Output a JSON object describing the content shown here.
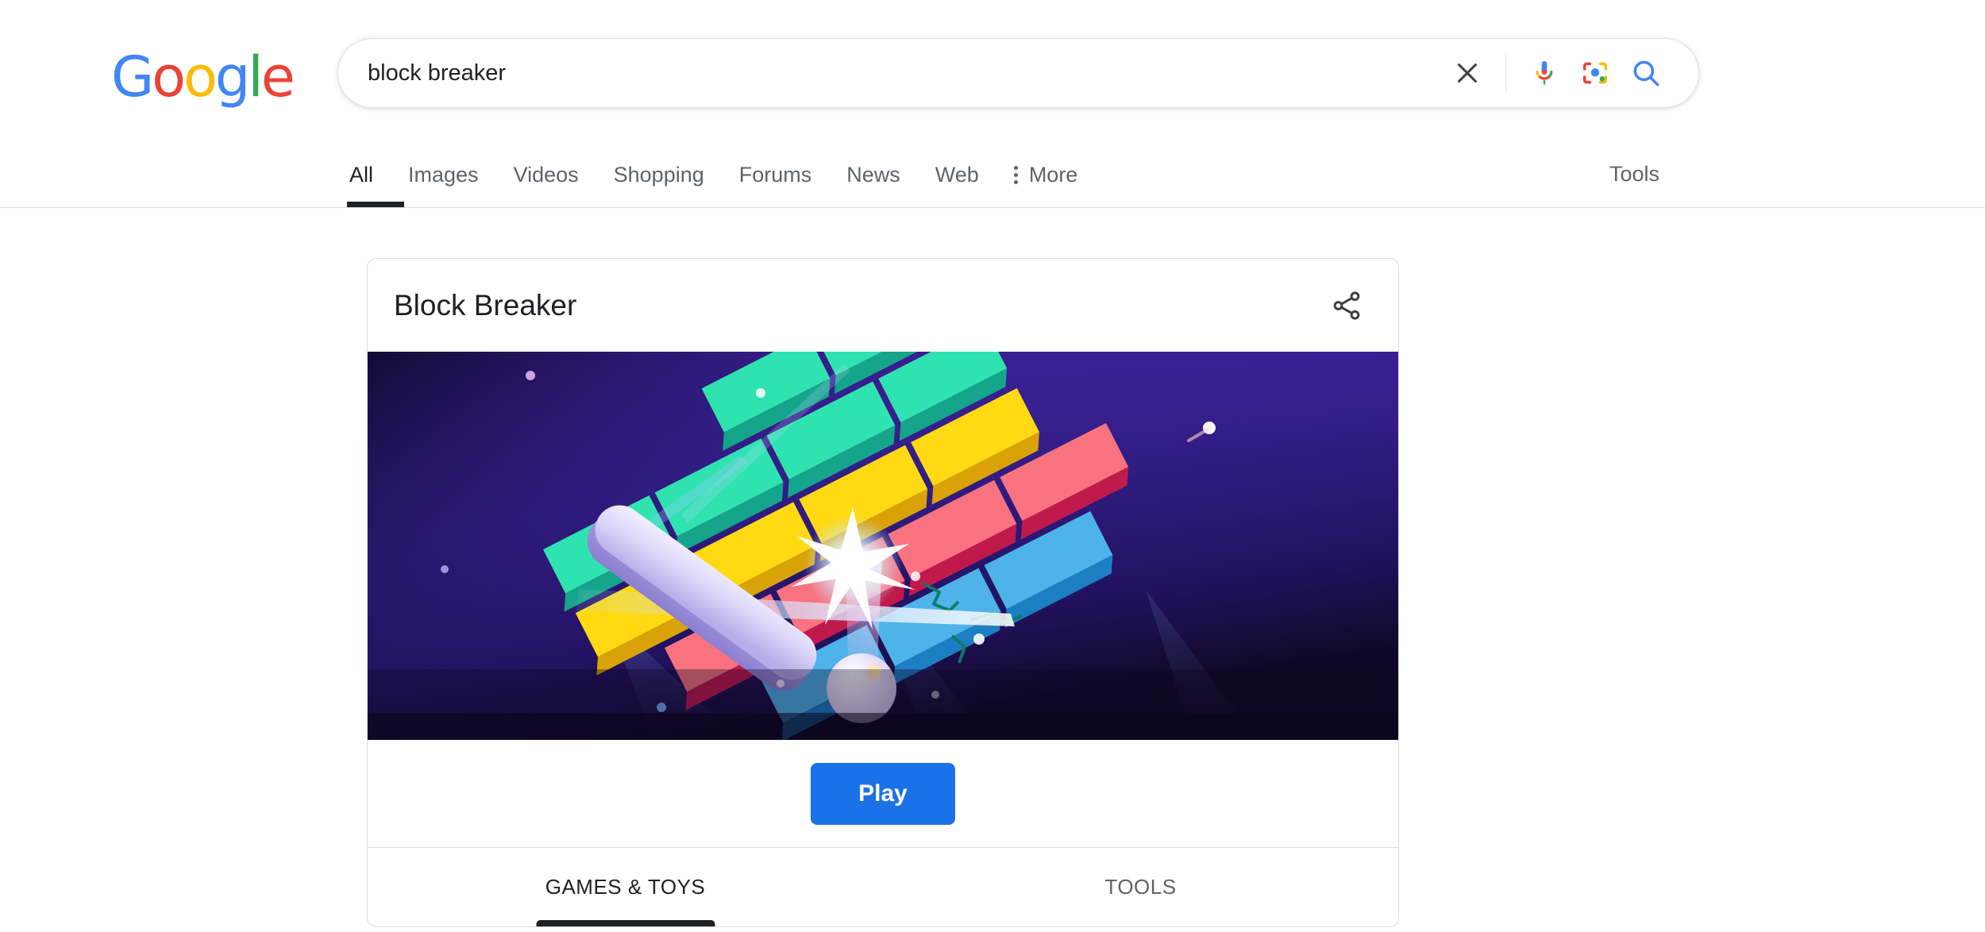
{
  "brand": {
    "logo_letters": [
      {
        "char": "G",
        "color": "#4285F4"
      },
      {
        "char": "o",
        "color": "#EA4335"
      },
      {
        "char": "o",
        "color": "#FBBC05"
      },
      {
        "char": "g",
        "color": "#4285F4"
      },
      {
        "char": "l",
        "color": "#34A853"
      },
      {
        "char": "e",
        "color": "#EA4335"
      }
    ],
    "logo_text": "Google"
  },
  "search": {
    "query": "block breaker",
    "placeholder": "Search",
    "clear_label": "Clear",
    "voice_label": "Search by voice",
    "lens_label": "Search by image",
    "submit_label": "Google Search"
  },
  "nav": {
    "items": [
      {
        "label": "All",
        "active": true
      },
      {
        "label": "Images",
        "active": false
      },
      {
        "label": "Videos",
        "active": false
      },
      {
        "label": "Shopping",
        "active": false
      },
      {
        "label": "Forums",
        "active": false
      },
      {
        "label": "News",
        "active": false
      },
      {
        "label": "Web",
        "active": false
      }
    ],
    "more_label": "More",
    "tools_label": "Tools"
  },
  "card": {
    "title": "Block Breaker",
    "share_label": "Share",
    "play_label": "Play",
    "tabs": [
      {
        "label": "GAMES & TOYS",
        "active": true
      },
      {
        "label": "TOOLS",
        "active": false
      }
    ]
  },
  "artwork": {
    "alt": "Block Breaker game artwork: glowing ball striking a cracked teal brick with a lavender paddle below",
    "background_top": "#3a1f8f",
    "background_bottom": "#120a2e",
    "paddle_color": "#d8d3f5",
    "ball_color": "#e3d6f2",
    "brick_colors": {
      "teal": "#2fe3b0",
      "teal_dark": "#15a58a",
      "yellow": "#ffd912",
      "yellow_dark": "#d9a206",
      "coral": "#f8737f",
      "coral_dark": "#c01a4c",
      "blue": "#4db3e8",
      "blue_dark": "#1c7fc4"
    }
  },
  "colors": {
    "accent_blue": "#1b72e8",
    "text_primary": "#202124",
    "text_secondary": "#5f6368",
    "border": "#dadce0",
    "page_background": "#ffffff"
  }
}
